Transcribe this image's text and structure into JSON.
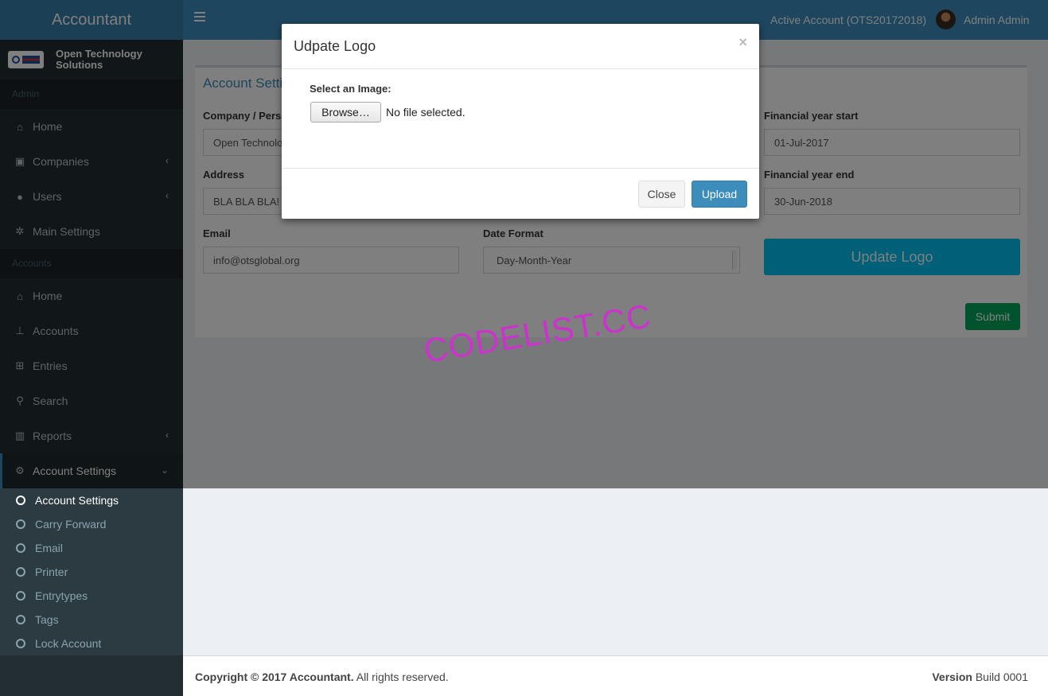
{
  "app": {
    "title": "Accountant"
  },
  "topbar": {
    "active_account": "Active Account (OTS20172018)",
    "user_name": "Admin Admin"
  },
  "sidebar": {
    "brand": "Open Technology Solutions",
    "section_admin": "Admin",
    "admin_items": [
      {
        "label": "Home",
        "icon": "home-icon"
      },
      {
        "label": "Companies",
        "icon": "building-icon"
      },
      {
        "label": "Users",
        "icon": "users-icon"
      },
      {
        "label": "Main Settings",
        "icon": "cogs-icon"
      }
    ],
    "section_accounts": "Accounts",
    "account_items": [
      {
        "label": "Home",
        "icon": "home-icon"
      },
      {
        "label": "Accounts",
        "icon": "sitemap-icon"
      },
      {
        "label": "Entries",
        "icon": "plus-square-icon"
      },
      {
        "label": "Search",
        "icon": "search-icon"
      },
      {
        "label": "Reports",
        "icon": "bar-chart-icon"
      },
      {
        "label": "Account Settings",
        "icon": "gear-icon"
      }
    ],
    "settings_sub": [
      "Account Settings",
      "Carry Forward",
      "Email",
      "Printer",
      "Entrytypes",
      "Tags",
      "Lock Account"
    ]
  },
  "form": {
    "box_title": "Account Settings",
    "company_label": "Company / Person Name",
    "company_value": "Open Technology Solutions",
    "address_label": "Address",
    "address_value": "BLA BLA BLA!",
    "email_label": "Email",
    "email_value": "info@otsglobal.org",
    "date_format_label": "Date Format",
    "date_format_value": "Day-Month-Year",
    "fy_start_label": "Financial year start",
    "fy_start_value": "01-Jul-2017",
    "fy_end_label": "Financial year end",
    "fy_end_value": "30-Jun-2018",
    "update_logo_label": "Update Logo",
    "submit_label": "Submit"
  },
  "modal": {
    "title": "Udpate Logo",
    "close_x": "×",
    "select_label": "Select an Image:",
    "browse_label": "Browse…",
    "file_status": "No file selected.",
    "close_label": "Close",
    "upload_label": "Upload"
  },
  "footer": {
    "copyright_bold": "Copyright © 2017 Accountant.",
    "copyright_rest": " All rights reserved.",
    "version_bold": "Version",
    "version_rest": " Build 0001"
  },
  "watermark": "CODELIST.CC",
  "colors": {
    "topbar": "#3c8dbc",
    "logo_box": "#367fa9",
    "sidebar": "#222d32",
    "info_button": "#00c0ef",
    "success_button": "#00a65a",
    "primary_button": "#3c8dbc",
    "watermark": "#cc33cc"
  }
}
